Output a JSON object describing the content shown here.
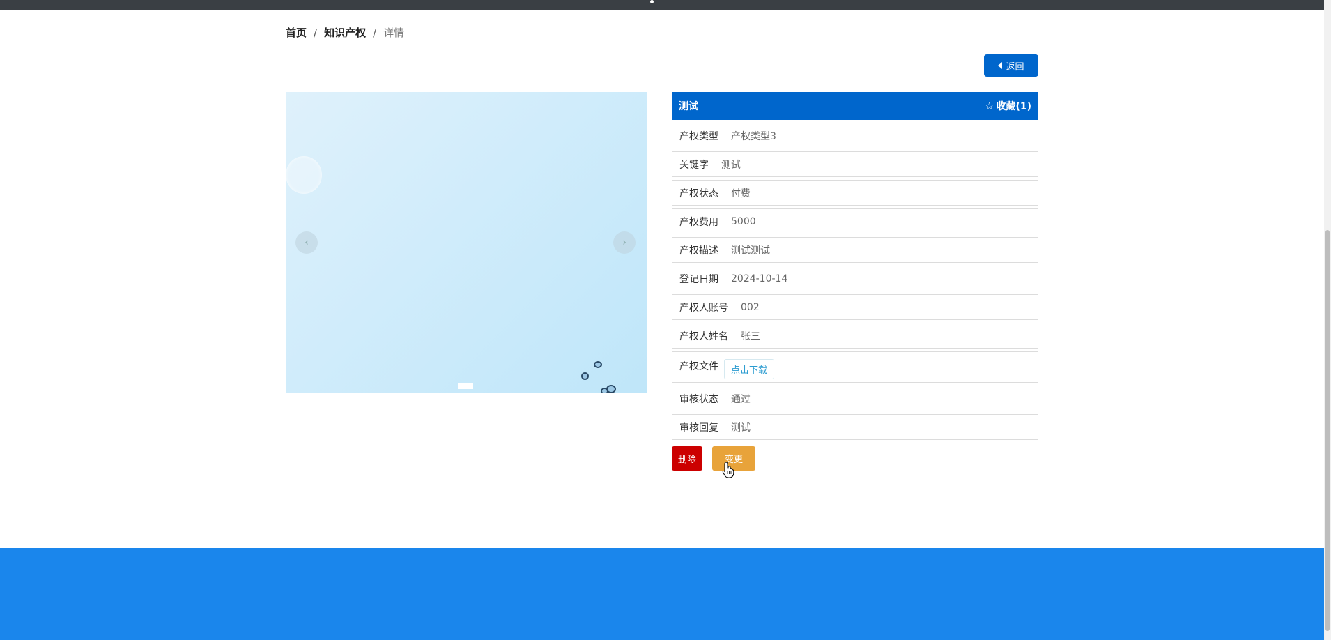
{
  "breadcrumb": {
    "home": "首页",
    "section": "知识产权",
    "current": "详情",
    "separator": "/"
  },
  "back_button": {
    "label": "返回"
  },
  "carousel": {
    "prev_glyph": "‹",
    "next_glyph": "›",
    "active_slide": 1,
    "slide_count": 1
  },
  "detail": {
    "title": "测试",
    "favorite_label": "收藏(1)",
    "favorite_icon": "star-outline-icon",
    "rows": [
      {
        "label": "产权类型",
        "value": "产权类型3"
      },
      {
        "label": "关键字",
        "value": "测试"
      },
      {
        "label": "产权状态",
        "value": "付费"
      },
      {
        "label": "产权费用",
        "value": "5000"
      },
      {
        "label": "产权描述",
        "value": "测试测试"
      },
      {
        "label": "登记日期",
        "value": "2024-10-14"
      },
      {
        "label": "产权人账号",
        "value": "002"
      },
      {
        "label": "产权人姓名",
        "value": "张三"
      },
      {
        "label": "产权文件",
        "download_label": "点击下载"
      },
      {
        "label": "审核状态",
        "value": "通过"
      },
      {
        "label": "审核回复",
        "value": "测试"
      }
    ]
  },
  "actions": {
    "delete_label": "删除",
    "change_label": "变更"
  },
  "colors": {
    "primary": "#0066cc",
    "delete": "#cc0000",
    "change": "#e8a33a",
    "footer": "#1a86ec"
  }
}
